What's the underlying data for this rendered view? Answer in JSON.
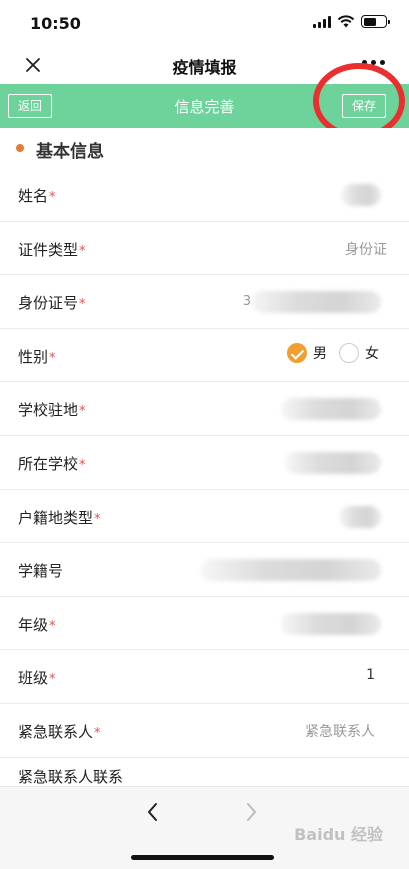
{
  "status_bar": {
    "time": "10:50"
  },
  "nav": {
    "title": "疫情填报"
  },
  "header": {
    "back_label": "返回",
    "title": "信息完善",
    "save_label": "保存"
  },
  "section": {
    "title": "基本信息"
  },
  "fields": {
    "name": {
      "label": "姓名",
      "required": "*"
    },
    "id_type": {
      "label": "证件类型",
      "required": "*",
      "placeholder": "身份证"
    },
    "id_number": {
      "label": "身份证号",
      "required": "*",
      "partial": "3"
    },
    "gender": {
      "label": "性别",
      "required": "*",
      "option_male": "男",
      "option_female": "女",
      "selected": "男"
    },
    "school_location": {
      "label": "学校驻地",
      "required": "*"
    },
    "school": {
      "label": "所在学校",
      "required": "*"
    },
    "hukou_type": {
      "label": "户籍地类型",
      "required": "*"
    },
    "student_number": {
      "label": "学籍号"
    },
    "grade": {
      "label": "年级",
      "required": "*"
    },
    "class": {
      "label": "班级",
      "required": "*",
      "value": "1"
    },
    "emergency_contact": {
      "label": "紧急联系人",
      "required": "*",
      "placeholder": "紧急联系人"
    },
    "emergency_contact_phone": {
      "label": "紧急联系人联系"
    }
  },
  "watermark": "Baidu 经验",
  "colors": {
    "header_green": "#6ed39b",
    "accent_orange": "#f0a030",
    "required_red": "#e45050",
    "annotation_red": "#e8312f"
  }
}
